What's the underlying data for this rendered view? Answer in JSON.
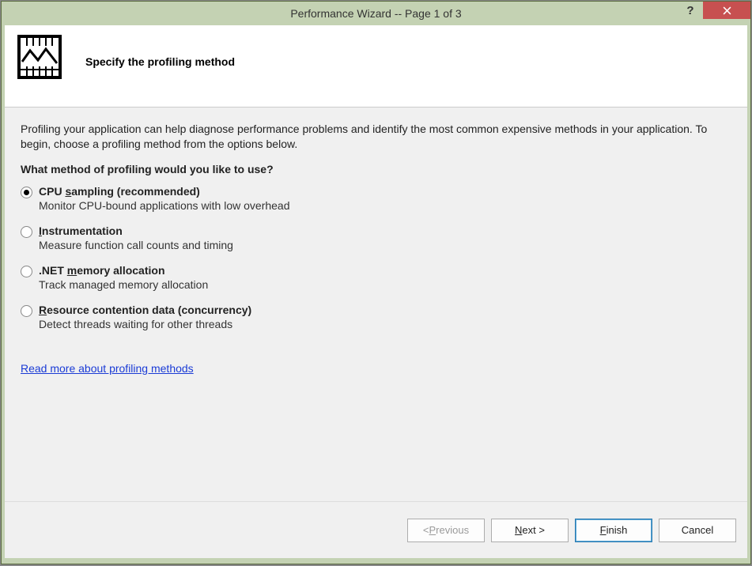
{
  "titlebar": {
    "title": "Performance Wizard -- Page 1 of 3"
  },
  "header": {
    "title": "Specify the profiling method"
  },
  "content": {
    "intro": "Profiling your application can help diagnose performance problems and identify the most common expensive methods in your application. To begin, choose a profiling method from the options below.",
    "question": "What method of profiling would you like to use?",
    "options": [
      {
        "label_pre": "CPU ",
        "label_ul": "s",
        "label_post": "ampling (recommended)",
        "desc": "Monitor CPU-bound applications with low overhead",
        "checked": true
      },
      {
        "label_pre": "",
        "label_ul": "I",
        "label_post": "nstrumentation",
        "desc": "Measure function call counts and timing",
        "checked": false
      },
      {
        "label_pre": ".NET ",
        "label_ul": "m",
        "label_post": "emory allocation",
        "desc": "Track managed memory allocation",
        "checked": false
      },
      {
        "label_pre": "",
        "label_ul": "R",
        "label_post": "esource contention data (concurrency)",
        "desc": "Detect threads waiting for other threads",
        "checked": false
      }
    ],
    "link": "Read more about profiling methods"
  },
  "footer": {
    "previous_pre": "< ",
    "previous_ul": "P",
    "previous_post": "revious",
    "next_ul": "N",
    "next_post": "ext >",
    "finish_ul": "F",
    "finish_post": "inish",
    "cancel": "Cancel"
  }
}
